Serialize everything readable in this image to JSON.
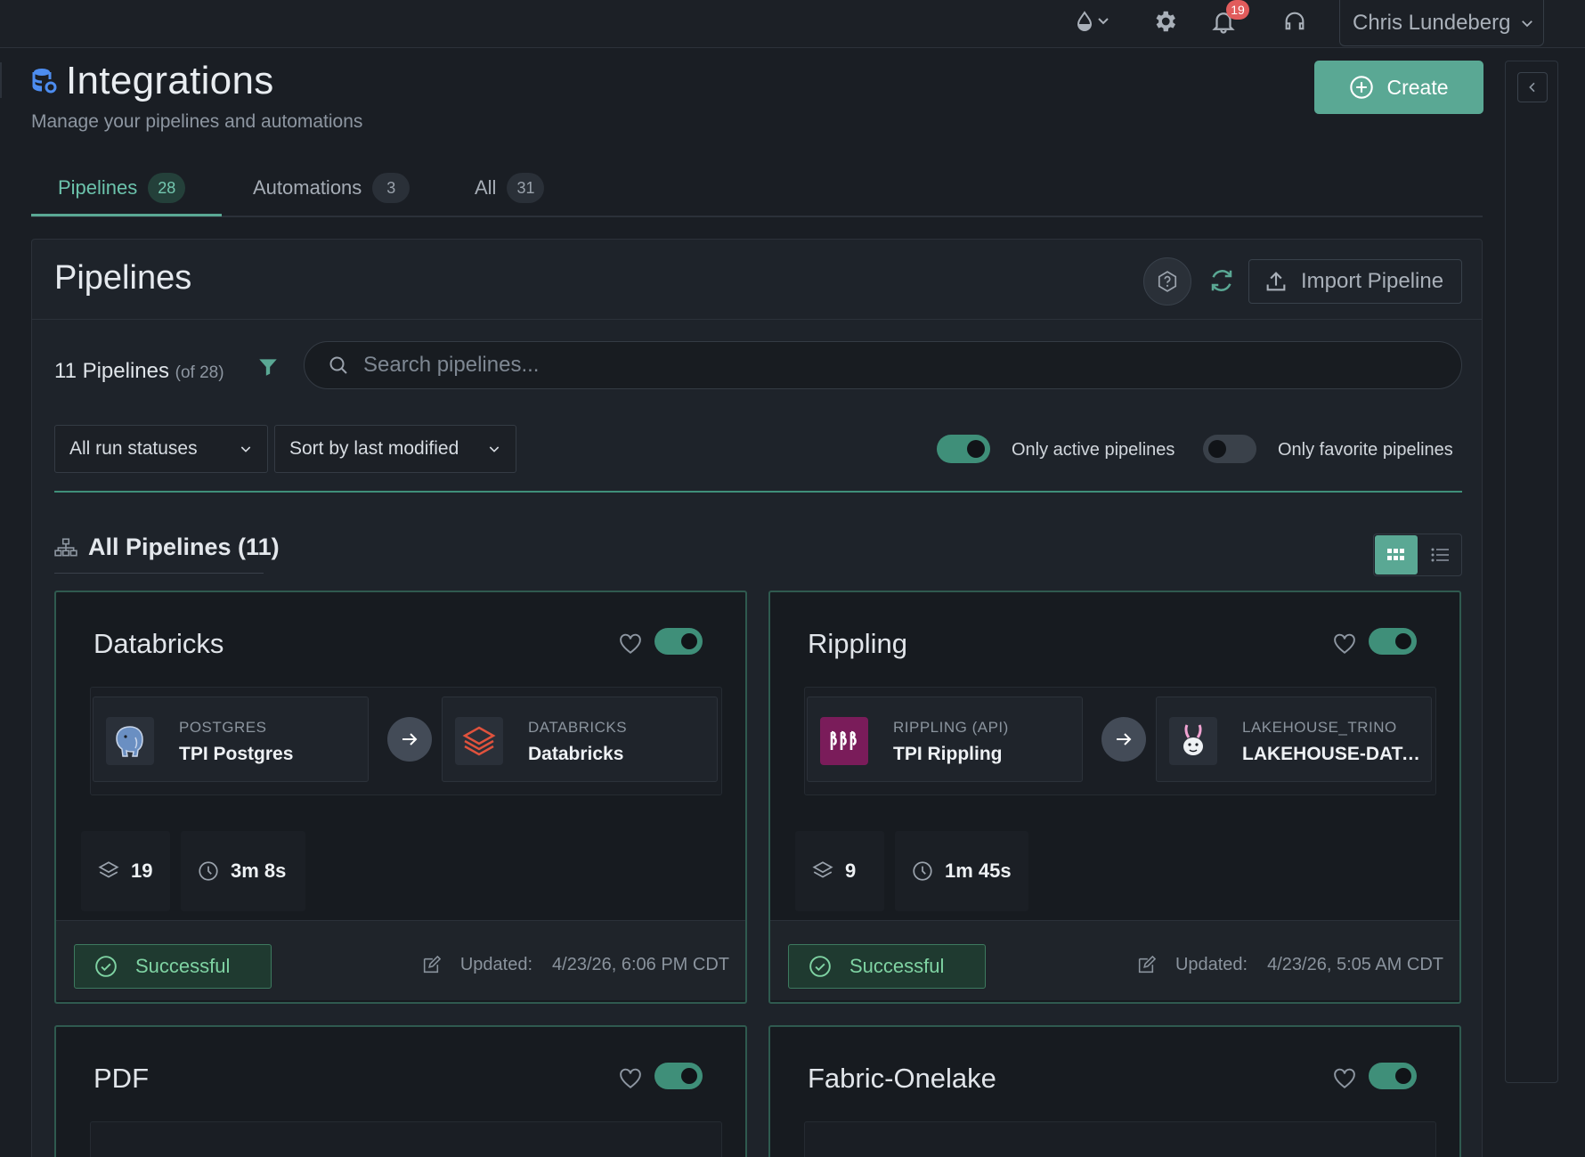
{
  "topbar": {
    "notifications_count": "19",
    "user_name": "Chris Lundeberg"
  },
  "header": {
    "title": "Integrations",
    "subtitle": "Manage your pipelines and automations",
    "create_label": "Create"
  },
  "tabs": [
    {
      "label": "Pipelines",
      "count": "28",
      "active": true
    },
    {
      "label": "Automations",
      "count": "3",
      "active": false
    },
    {
      "label": "All",
      "count": "31",
      "active": false
    }
  ],
  "panel": {
    "title": "Pipelines",
    "import_label": "Import Pipeline",
    "count_text": "11 Pipelines",
    "count_of": "(of 28)",
    "search_placeholder": "Search pipelines...",
    "status_filter": "All run statuses",
    "sort_filter": "Sort by last modified",
    "only_active_label": "Only active pipelines",
    "only_active_on": true,
    "only_favorite_label": "Only favorite pipelines",
    "only_favorite_on": false,
    "section_title": "All Pipelines (11)"
  },
  "cards": [
    {
      "name": "Databricks",
      "enabled": true,
      "source": {
        "type": "POSTGRES",
        "name": "TPI Postgres"
      },
      "dest": {
        "type": "DATABRICKS",
        "name": "Databricks"
      },
      "streams": "19",
      "duration": "3m 8s",
      "status": "Successful",
      "updated_label": "Updated:",
      "updated": "4/23/26, 6:06 PM CDT"
    },
    {
      "name": "Rippling",
      "enabled": true,
      "source": {
        "type": "RIPPLING (API)",
        "name": "TPI Rippling"
      },
      "dest": {
        "type": "LAKEHOUSE_TRINO",
        "name": "LAKEHOUSE-DATA..."
      },
      "streams": "9",
      "duration": "1m 45s",
      "status": "Successful",
      "updated_label": "Updated:",
      "updated": "4/23/26, 5:05 AM CDT"
    },
    {
      "name": "PDF",
      "enabled": true
    },
    {
      "name": "Fabric-Onelake",
      "enabled": true
    }
  ],
  "colors": {
    "accent": "#5aa894",
    "background": "#1a1e24",
    "success": "#7fd3a3",
    "notification": "#e15c5c"
  }
}
